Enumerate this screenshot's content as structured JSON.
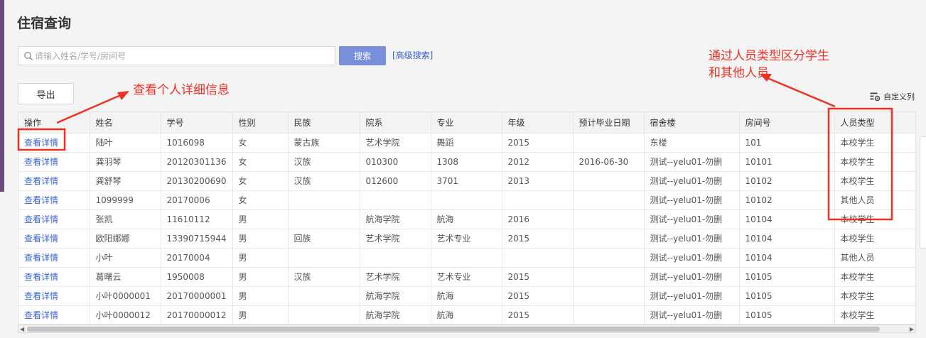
{
  "page": {
    "title": "住宿查询"
  },
  "search": {
    "placeholder": "请输入姓名/学号/房间号",
    "button_label": "搜索",
    "advanced_label": "[高级搜索]"
  },
  "toolbar": {
    "export_label": "导出",
    "custom_columns_label": "自定义列"
  },
  "table": {
    "columns": [
      "操作",
      "姓名",
      "学号",
      "性别",
      "民族",
      "院系",
      "专业",
      "年级",
      "预计毕业日期",
      "宿舍楼",
      "房间号",
      "人员类型"
    ],
    "rows": [
      {
        "action": "查看详情",
        "name": "陆叶",
        "student_id": "1016098",
        "gender": "女",
        "ethnicity": "蒙古族",
        "department": "艺术学院",
        "major": "舞蹈",
        "grade": "2015",
        "graduation": "",
        "building": "东楼",
        "room": "101",
        "type": "本校学生"
      },
      {
        "action": "查看详情",
        "name": "龚羽琴",
        "student_id": "20120301136",
        "gender": "女",
        "ethnicity": "汉族",
        "department": "010300",
        "major": "1308",
        "grade": "2012",
        "graduation": "2016-06-30",
        "building": "测试--yelu01-勿删",
        "room": "10101",
        "type": "本校学生"
      },
      {
        "action": "查看详情",
        "name": "龚舒琴",
        "student_id": "20130200690",
        "gender": "女",
        "ethnicity": "汉族",
        "department": "012600",
        "major": "3701",
        "grade": "2013",
        "graduation": "",
        "building": "测试--yelu01-勿删",
        "room": "10102",
        "type": "本校学生"
      },
      {
        "action": "查看详情",
        "name": "1099999",
        "student_id": "20170006",
        "gender": "女",
        "ethnicity": "",
        "department": "",
        "major": "",
        "grade": "",
        "graduation": "",
        "building": "测试--yelu01-勿删",
        "room": "10102",
        "type": "其他人员"
      },
      {
        "action": "查看详情",
        "name": "张凯",
        "student_id": "11610112",
        "gender": "男",
        "ethnicity": "",
        "department": "航海学院",
        "major": "航海",
        "grade": "2016",
        "graduation": "",
        "building": "测试--yelu01-勿删",
        "room": "10104",
        "type": "本校学生"
      },
      {
        "action": "查看详情",
        "name": "欧阳娜娜",
        "student_id": "13390715944",
        "gender": "男",
        "ethnicity": "回族",
        "department": "艺术学院",
        "major": "艺术专业",
        "grade": "2015",
        "graduation": "",
        "building": "测试--yelu01-勿删",
        "room": "10104",
        "type": "本校学生"
      },
      {
        "action": "查看详情",
        "name": "小叶",
        "student_id": "20170004",
        "gender": "男",
        "ethnicity": "",
        "department": "",
        "major": "",
        "grade": "",
        "graduation": "",
        "building": "测试--yelu01-勿删",
        "room": "10104",
        "type": "其他人员"
      },
      {
        "action": "查看详情",
        "name": "葛曙云",
        "student_id": "1950008",
        "gender": "男",
        "ethnicity": "汉族",
        "department": "艺术学院",
        "major": "艺术专业",
        "grade": "2015",
        "graduation": "",
        "building": "测试--yelu01-勿删",
        "room": "10105",
        "type": "本校学生"
      },
      {
        "action": "查看详情",
        "name": "小叶0000001",
        "student_id": "20170000001",
        "gender": "男",
        "ethnicity": "",
        "department": "航海学院",
        "major": "航海",
        "grade": "2015",
        "graduation": "",
        "building": "测试--yelu01-勿删",
        "room": "10105",
        "type": "本校学生"
      },
      {
        "action": "查看详情",
        "name": "小叶0000012",
        "student_id": "20170000012",
        "gender": "男",
        "ethnicity": "",
        "department": "航海学院",
        "major": "航海",
        "grade": "2015",
        "graduation": "",
        "building": "测试--yelu01-勿删",
        "room": "10105",
        "type": "本校学生"
      }
    ]
  },
  "annotations": {
    "view_details": "查看个人详细信息",
    "person_type_line1": "通过人员类型区分学生",
    "person_type_line2": "和其他人员"
  },
  "colors": {
    "accent": "#7a8fd9",
    "link": "#3a62c8",
    "annotation": "#ee3124",
    "sidebar_strip": "#6b4a7c"
  }
}
